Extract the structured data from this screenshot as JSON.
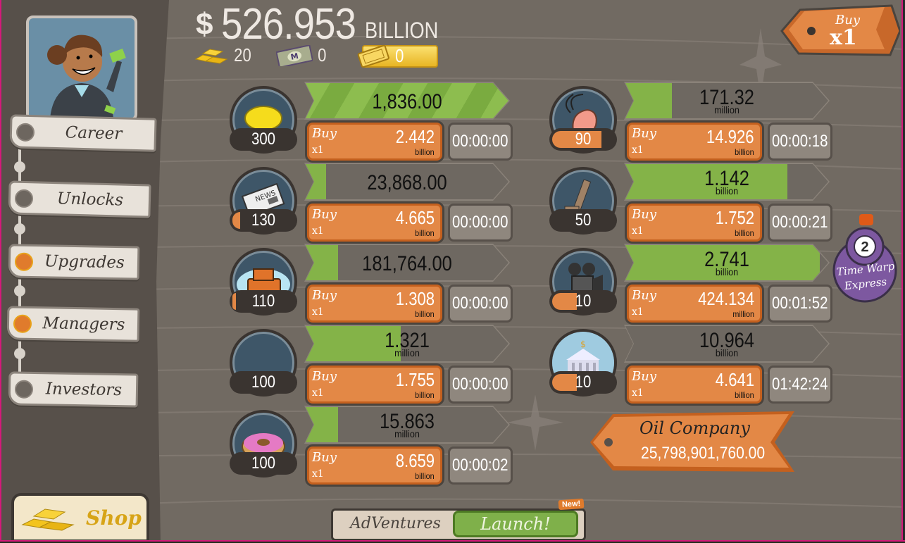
{
  "header": {
    "money_symbol": "$",
    "money_amount": "526.953",
    "money_unit": "BILLION",
    "gold_bars": "20",
    "megabucks": "0",
    "tickets": "0"
  },
  "buy_multiplier": {
    "label": "Buy",
    "value": "x1"
  },
  "sidebar": {
    "items": [
      {
        "label": "Career",
        "notified": false
      },
      {
        "label": "Unlocks",
        "notified": false
      },
      {
        "label": "Upgrades",
        "notified": true
      },
      {
        "label": "Managers",
        "notified": true
      },
      {
        "label": "Investors",
        "notified": false
      }
    ],
    "shop_label": "Shop"
  },
  "businesses": [
    {
      "icon": "lemon-icon",
      "owned": "300",
      "milestone_progress": 0,
      "revenue": "1,836.00",
      "revenue_unit": "",
      "cycle_progress": 1.0,
      "striped": true,
      "buy_label": "Buy",
      "buy_mult": "x1",
      "price": "2.442",
      "price_unit": "billion",
      "timer": "00:00:00"
    },
    {
      "icon": "newspaper-icon",
      "owned": "130",
      "milestone_progress": 0.12,
      "revenue": "23,868.00",
      "revenue_unit": "",
      "cycle_progress": 0.1,
      "striped": false,
      "buy_label": "Buy",
      "buy_mult": "x1",
      "price": "4.665",
      "price_unit": "billion",
      "timer": "00:00:00"
    },
    {
      "icon": "car-wash-icon",
      "owned": "110",
      "milestone_progress": 0.06,
      "revenue": "181,764.00",
      "revenue_unit": "",
      "cycle_progress": 0.16,
      "striped": false,
      "buy_label": "Buy",
      "buy_mult": "x1",
      "price": "1.308",
      "price_unit": "billion",
      "timer": "00:00:00"
    },
    {
      "icon": "pizza-icon",
      "owned": "100",
      "milestone_progress": 0,
      "revenue": "1.321",
      "revenue_unit": "million",
      "cycle_progress": 0.47,
      "striped": false,
      "buy_label": "Buy",
      "buy_mult": "x1",
      "price": "1.755",
      "price_unit": "billion",
      "timer": "00:00:00"
    },
    {
      "icon": "donut-icon",
      "owned": "100",
      "milestone_progress": 0,
      "revenue": "15.863",
      "revenue_unit": "million",
      "cycle_progress": 0.16,
      "striped": false,
      "buy_label": "Buy",
      "buy_mult": "x1",
      "price": "8.659",
      "price_unit": "billion",
      "timer": "00:00:02"
    },
    {
      "icon": "shrimp-icon",
      "owned": "90",
      "milestone_progress": 0.8,
      "revenue": "171.32",
      "revenue_unit": "million",
      "cycle_progress": 0.23,
      "striped": false,
      "buy_label": "Buy",
      "buy_mult": "x1",
      "price": "14.926",
      "price_unit": "billion",
      "timer": "00:00:18"
    },
    {
      "icon": "hockey-icon",
      "owned": "50",
      "milestone_progress": 0,
      "revenue": "1.142",
      "revenue_unit": "billion",
      "cycle_progress": 0.8,
      "striped": false,
      "buy_label": "Buy",
      "buy_mult": "x1",
      "price": "1.752",
      "price_unit": "billion",
      "timer": "00:00:21"
    },
    {
      "icon": "movie-camera-icon",
      "owned": "10",
      "milestone_progress": 0.4,
      "revenue": "2.741",
      "revenue_unit": "billion",
      "cycle_progress": 0.96,
      "striped": false,
      "buy_label": "Buy",
      "buy_mult": "x1",
      "price": "424.134",
      "price_unit": "million",
      "timer": "00:01:52"
    },
    {
      "icon": "bank-icon",
      "owned": "10",
      "milestone_progress": 0.4,
      "revenue": "10.964",
      "revenue_unit": "billion",
      "cycle_progress": 0,
      "striped": false,
      "buy_label": "Buy",
      "buy_mult": "x1",
      "price": "4.641",
      "price_unit": "billion",
      "timer": "01:42:24"
    }
  ],
  "next_unlock": {
    "name": "Oil Company",
    "cost": "25,798,901,760.00"
  },
  "time_warp": {
    "count": "2",
    "line1": "Time Warp",
    "line2": "Express"
  },
  "adventures": {
    "label": "AdVentures",
    "launch_label": "Launch!",
    "badge": "New!"
  },
  "colors": {
    "accent_orange": "#e38846",
    "progress_green": "#84b348",
    "background": "#716a62"
  }
}
